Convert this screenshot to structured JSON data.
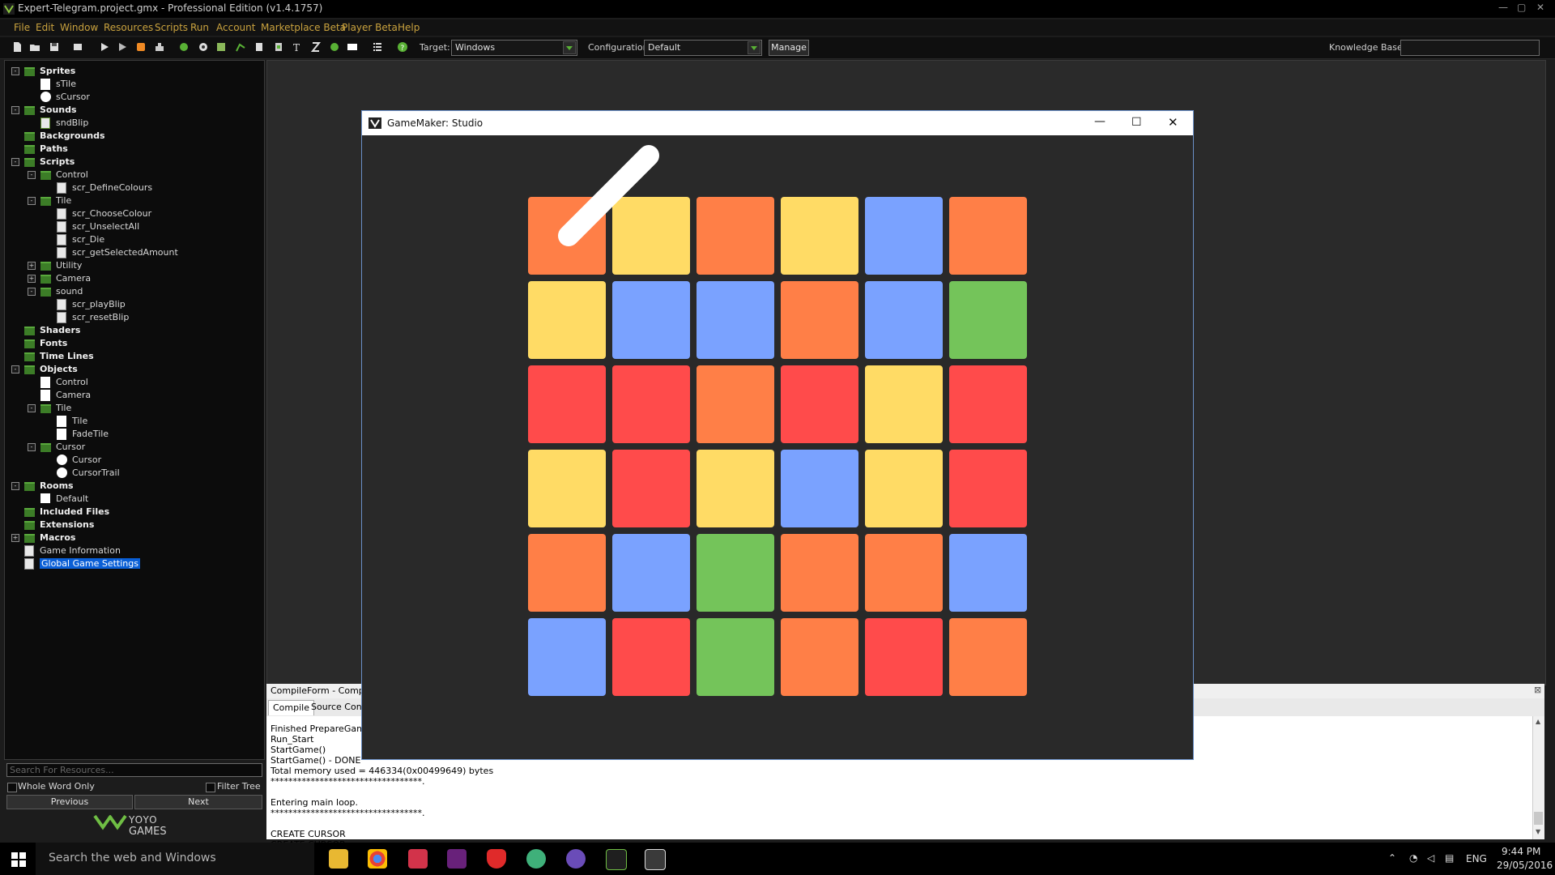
{
  "window": {
    "title": "Expert-Telegram.project.gmx  -  Professional Edition (v1.4.1757)"
  },
  "menu": [
    "File",
    "Edit",
    "Window",
    "Resources",
    "Scripts",
    "Run",
    "Account",
    "Marketplace Beta",
    "Player Beta",
    "Help"
  ],
  "toolbar": {
    "target_label": "Target:",
    "target_value": "Windows",
    "config_label": "Configuration:",
    "config_value": "Default",
    "manage_label": "Manage",
    "kb_label": "Knowledge Base:",
    "kb_value": ""
  },
  "tree": [
    {
      "label": "Sprites",
      "bold": true,
      "level": 0,
      "exp": "-",
      "icon": "folder"
    },
    {
      "label": "sTile",
      "bold": false,
      "level": 1,
      "exp": "",
      "icon": "sprite"
    },
    {
      "label": "sCursor",
      "bold": false,
      "level": 1,
      "exp": "",
      "icon": "circle"
    },
    {
      "label": "Sounds",
      "bold": true,
      "level": 0,
      "exp": "-",
      "icon": "folder"
    },
    {
      "label": "sndBlip",
      "bold": false,
      "level": 1,
      "exp": "",
      "icon": "sound"
    },
    {
      "label": "Backgrounds",
      "bold": true,
      "level": 0,
      "exp": "",
      "icon": "folder"
    },
    {
      "label": "Paths",
      "bold": true,
      "level": 0,
      "exp": "",
      "icon": "folder"
    },
    {
      "label": "Scripts",
      "bold": true,
      "level": 0,
      "exp": "-",
      "icon": "folder"
    },
    {
      "label": "Control",
      "bold": false,
      "level": 1,
      "exp": "-",
      "icon": "folder"
    },
    {
      "label": "scr_DefineColours",
      "bold": false,
      "level": 2,
      "exp": "",
      "icon": "script"
    },
    {
      "label": "Tile",
      "bold": false,
      "level": 1,
      "exp": "-",
      "icon": "folder"
    },
    {
      "label": "scr_ChooseColour",
      "bold": false,
      "level": 2,
      "exp": "",
      "icon": "script"
    },
    {
      "label": "scr_UnselectAll",
      "bold": false,
      "level": 2,
      "exp": "",
      "icon": "script"
    },
    {
      "label": "scr_Die",
      "bold": false,
      "level": 2,
      "exp": "",
      "icon": "script"
    },
    {
      "label": "scr_getSelectedAmount",
      "bold": false,
      "level": 2,
      "exp": "",
      "icon": "script"
    },
    {
      "label": "Utility",
      "bold": false,
      "level": 1,
      "exp": "+",
      "icon": "folder"
    },
    {
      "label": "Camera",
      "bold": false,
      "level": 1,
      "exp": "+",
      "icon": "folder"
    },
    {
      "label": "sound",
      "bold": false,
      "level": 1,
      "exp": "-",
      "icon": "folder"
    },
    {
      "label": "scr_playBlip",
      "bold": false,
      "level": 2,
      "exp": "",
      "icon": "script"
    },
    {
      "label": "scr_resetBlip",
      "bold": false,
      "level": 2,
      "exp": "",
      "icon": "script"
    },
    {
      "label": "Shaders",
      "bold": true,
      "level": 0,
      "exp": "",
      "icon": "folder"
    },
    {
      "label": "Fonts",
      "bold": true,
      "level": 0,
      "exp": "",
      "icon": "folder"
    },
    {
      "label": "Time Lines",
      "bold": true,
      "level": 0,
      "exp": "",
      "icon": "folder"
    },
    {
      "label": "Objects",
      "bold": true,
      "level": 0,
      "exp": "-",
      "icon": "folder"
    },
    {
      "label": "Control",
      "bold": false,
      "level": 1,
      "exp": "",
      "icon": "sprite"
    },
    {
      "label": "Camera",
      "bold": false,
      "level": 1,
      "exp": "",
      "icon": "sprite"
    },
    {
      "label": "Tile",
      "bold": false,
      "level": 1,
      "exp": "-",
      "icon": "folder"
    },
    {
      "label": "Tile",
      "bold": false,
      "level": 2,
      "exp": "",
      "icon": "sprite"
    },
    {
      "label": "FadeTile",
      "bold": false,
      "level": 2,
      "exp": "",
      "icon": "sprite"
    },
    {
      "label": "Cursor",
      "bold": false,
      "level": 1,
      "exp": "-",
      "icon": "folder"
    },
    {
      "label": "Cursor",
      "bold": false,
      "level": 2,
      "exp": "",
      "icon": "circle"
    },
    {
      "label": "CursorTrail",
      "bold": false,
      "level": 2,
      "exp": "",
      "icon": "circle"
    },
    {
      "label": "Rooms",
      "bold": true,
      "level": 0,
      "exp": "-",
      "icon": "folder"
    },
    {
      "label": "Default",
      "bold": false,
      "level": 1,
      "exp": "",
      "icon": "room"
    },
    {
      "label": "Included Files",
      "bold": true,
      "level": 0,
      "exp": "",
      "icon": "folder"
    },
    {
      "label": "Extensions",
      "bold": true,
      "level": 0,
      "exp": "",
      "icon": "folder"
    },
    {
      "label": "Macros",
      "bold": true,
      "level": 0,
      "exp": "+",
      "icon": "folder"
    },
    {
      "label": "Game Information",
      "bold": false,
      "level": 0,
      "exp": "",
      "icon": "info"
    },
    {
      "label": "Global Game Settings",
      "bold": false,
      "level": 0,
      "exp": "",
      "icon": "settings",
      "selected": true
    }
  ],
  "search": {
    "placeholder": "Search For Resources...",
    "whole_word": "Whole Word Only",
    "filter_tree": "Filter Tree",
    "previous": "Previous",
    "next": "Next"
  },
  "logo": {
    "top": "YOYO",
    "bottom": "GAMES"
  },
  "compile": {
    "header": "CompileForm - Compiled",
    "tabs": [
      "Compile",
      "Source Contr"
    ],
    "lines": [
      "Finished PrepareGame()",
      "Run_Start",
      "StartGame()",
      "StartGame() - DONE",
      "Total memory used = 446334(0x00499649) bytes",
      "**********************************.",
      "Entering main loop.",
      "**********************************.",
      "CREATE CURSOR",
      "CREATE CURSOR"
    ]
  },
  "game": {
    "title": "GameMaker: Studio",
    "grid": [
      [
        "orange",
        "yellow",
        "orange",
        "yellow",
        "blue",
        "orange"
      ],
      [
        "yellow",
        "blue",
        "blue",
        "orange",
        "blue",
        "green"
      ],
      [
        "red",
        "red",
        "orange",
        "red",
        "yellow",
        "red"
      ],
      [
        "yellow",
        "red",
        "yellow",
        "blue",
        "yellow",
        "red"
      ],
      [
        "orange",
        "blue",
        "green",
        "orange",
        "orange",
        "blue"
      ],
      [
        "blue",
        "red",
        "green",
        "orange",
        "red",
        "orange"
      ]
    ],
    "colors": {
      "orange": "#ff7f47",
      "yellow": "#ffdb65",
      "blue": "#7aa2ff",
      "green": "#74c45a",
      "red": "#ff4b4b"
    }
  },
  "taskbar": {
    "search_text": "Search the web and Windows",
    "lang": "ENG",
    "time": "9:44 PM",
    "date": "29/05/2016"
  }
}
